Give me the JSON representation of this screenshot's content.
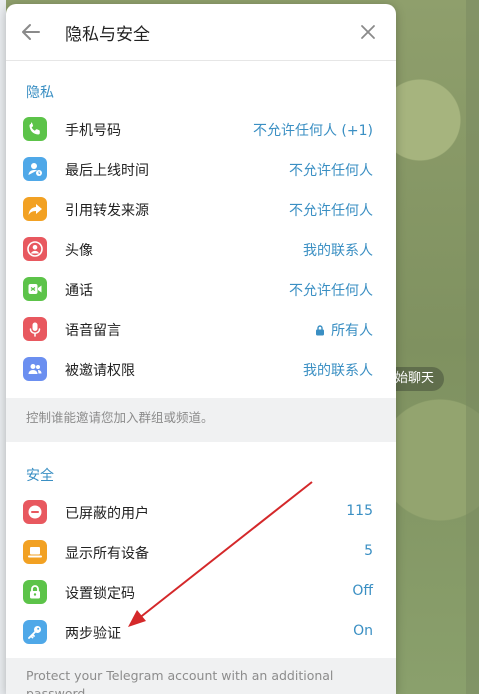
{
  "chat": {
    "pill_text": "始聊天"
  },
  "header": {
    "title": "隐私与安全"
  },
  "privacy": {
    "section_title": "隐私",
    "items": [
      {
        "label": "手机号码",
        "value": "不允许任何人 (+1)",
        "icon": "phone-icon",
        "color": "#5cc349"
      },
      {
        "label": "最后上线时间",
        "value": "不允许任何人",
        "icon": "user-clock-icon",
        "color": "#4fa8e8"
      },
      {
        "label": "引用转发来源",
        "value": "不允许任何人",
        "icon": "forward-icon",
        "color": "#f2a123"
      },
      {
        "label": "头像",
        "value": "我的联系人",
        "icon": "profile-icon",
        "color": "#e8585f"
      },
      {
        "label": "通话",
        "value": "不允许任何人",
        "icon": "call-icon",
        "color": "#5cc349"
      },
      {
        "label": "语音留言",
        "value": "所有人",
        "icon": "microphone-icon",
        "color": "#e8585f",
        "locked": true
      },
      {
        "label": "被邀请权限",
        "value": "我的联系人",
        "icon": "group-icon",
        "color": "#6b8ff0"
      }
    ],
    "hint": "控制谁能邀请您加入群组或频道。"
  },
  "security": {
    "section_title": "安全",
    "items": [
      {
        "label": "已屏蔽的用户",
        "value": "115",
        "icon": "block-icon",
        "color": "#e8585f"
      },
      {
        "label": "显示所有设备",
        "value": "5",
        "icon": "laptop-icon",
        "color": "#f2a123"
      },
      {
        "label": "设置锁定码",
        "value": "Off",
        "icon": "lock-icon",
        "color": "#5cc349"
      },
      {
        "label": "两步验证",
        "value": "On",
        "icon": "key-icon",
        "color": "#4fa8e8"
      }
    ],
    "hint": "Protect your Telegram account with an additional password."
  },
  "colors": {
    "accent": "#3a8fc3",
    "annotation_arrow": "#d4282a"
  }
}
